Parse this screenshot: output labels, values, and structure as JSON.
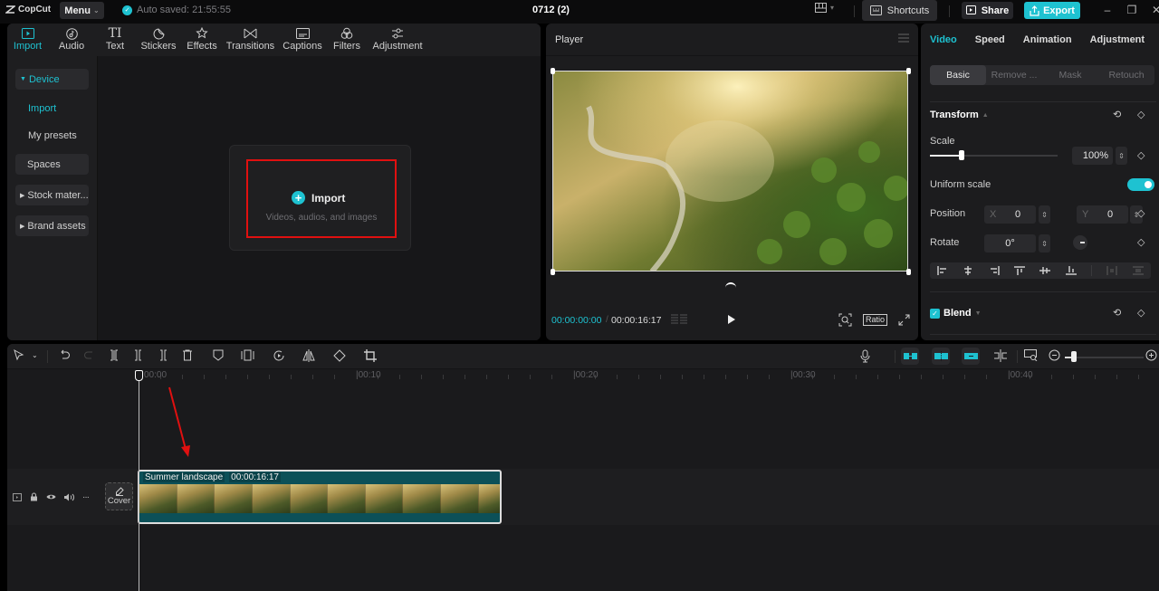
{
  "app": {
    "logo_text": "CopCut",
    "menu_label": "Menu",
    "autosave_text": "Auto saved: 21:55:55",
    "project_title": "0712 (2)",
    "shortcuts_label": "Shortcuts",
    "share_label": "Share",
    "export_label": "Export",
    "accent_color": "#1ec2d1"
  },
  "media": {
    "tabs": [
      {
        "label": "Import",
        "icon": "import-icon",
        "active": true
      },
      {
        "label": "Audio",
        "icon": "audio-icon"
      },
      {
        "label": "Text",
        "icon": "text-icon"
      },
      {
        "label": "Stickers",
        "icon": "stickers-icon"
      },
      {
        "label": "Effects",
        "icon": "effects-icon"
      },
      {
        "label": "Transitions",
        "icon": "transitions-icon"
      },
      {
        "label": "Captions",
        "icon": "captions-icon"
      },
      {
        "label": "Filters",
        "icon": "filters-icon"
      },
      {
        "label": "Adjustment",
        "icon": "adjustment-icon"
      }
    ],
    "sidebar": {
      "device": "Device",
      "import": "Import",
      "my_presets": "My presets",
      "spaces": "Spaces",
      "stock": "Stock mater...",
      "brand": "Brand assets"
    },
    "import_card": {
      "title": "Import",
      "subtitle": "Videos, audios, and images"
    }
  },
  "player": {
    "title": "Player",
    "current_time": "00:00:00:00",
    "total_time": "00:00:16:17",
    "ratio_label": "Ratio"
  },
  "props": {
    "tabs": [
      "Video",
      "Speed",
      "Animation",
      "Adjustment"
    ],
    "sub_tabs": [
      "Basic",
      "Remove ...",
      "Mask",
      "Retouch"
    ],
    "transform_title": "Transform",
    "scale_label": "Scale",
    "scale_value": "100%",
    "scale_fraction": 0.25,
    "uniform_scale_label": "Uniform scale",
    "uniform_scale_on": true,
    "position_label": "Position",
    "pos_x_label": "X",
    "pos_x": "0",
    "pos_y_label": "Y",
    "pos_y": "0",
    "rotate_label": "Rotate",
    "rotate_value": "0°",
    "blend_title": "Blend"
  },
  "timeline": {
    "ruler_labels": [
      "00:00",
      "00:10",
      "00:20",
      "00:30",
      "00:40"
    ],
    "clip": {
      "name": "Summer landscape",
      "duration": "00:00:16:17"
    },
    "cover_label": "Cover"
  }
}
